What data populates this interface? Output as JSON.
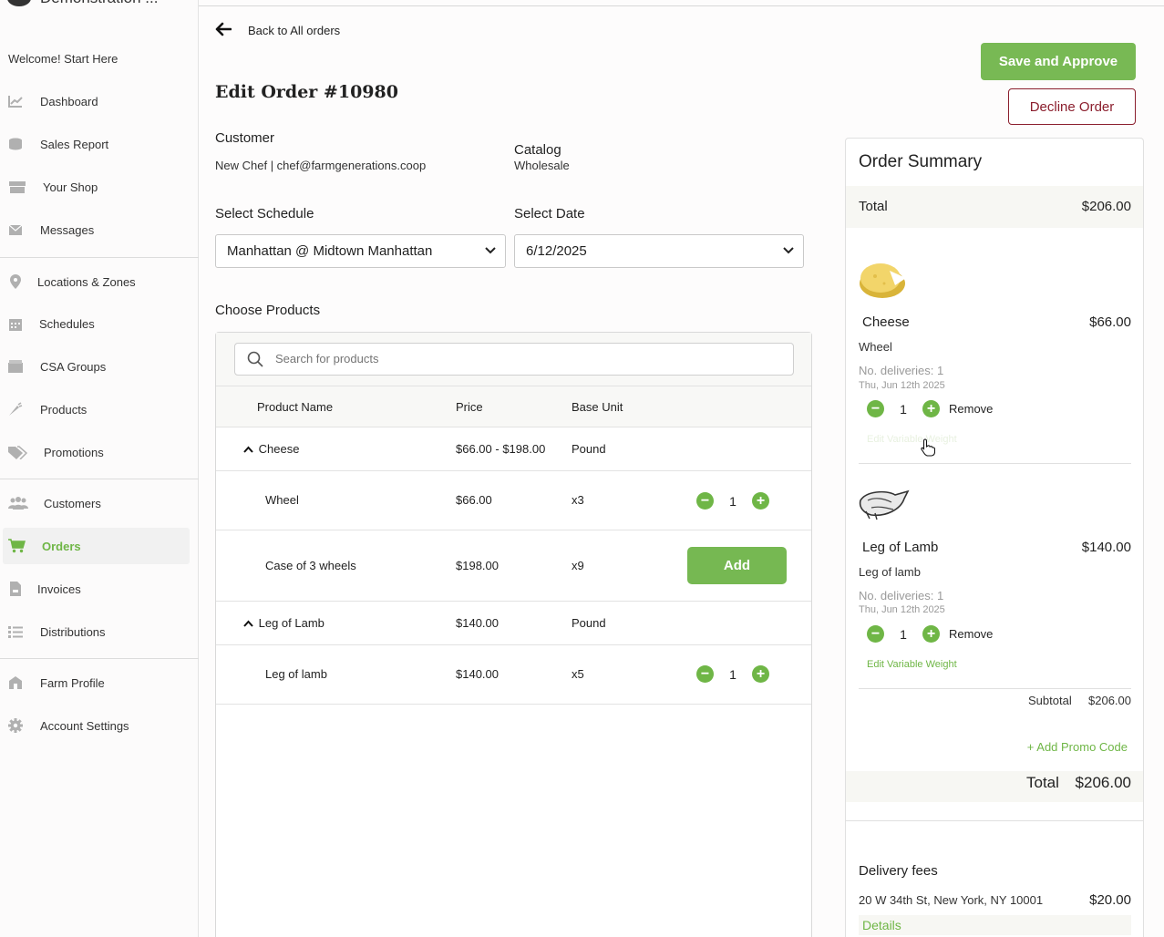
{
  "sidebar": {
    "brand": "Demonstration ...",
    "welcome": "Welcome! Start Here",
    "items": [
      {
        "label": "Dashboard",
        "icon": "chart-icon"
      },
      {
        "label": "Sales Report",
        "icon": "coins-icon"
      },
      {
        "label": "Your Shop",
        "icon": "store-icon"
      },
      {
        "label": "Messages",
        "icon": "envelope-icon"
      },
      {
        "label": "Locations & Zones",
        "icon": "map-pin-icon"
      },
      {
        "label": "Schedules",
        "icon": "calendar-icon"
      },
      {
        "label": "CSA Groups",
        "icon": "box-icon"
      },
      {
        "label": "Products",
        "icon": "carrot-icon"
      },
      {
        "label": "Promotions",
        "icon": "tags-icon"
      },
      {
        "label": "Customers",
        "icon": "users-icon"
      },
      {
        "label": "Orders",
        "icon": "cart-icon"
      },
      {
        "label": "Invoices",
        "icon": "invoice-icon"
      },
      {
        "label": "Distributions",
        "icon": "list-icon"
      },
      {
        "label": "Farm Profile",
        "icon": "barn-icon"
      },
      {
        "label": "Account Settings",
        "icon": "gear-icon"
      }
    ]
  },
  "header": {
    "back_label": "Back to All orders",
    "title": "Edit Order #10980"
  },
  "order": {
    "customer_label": "Customer",
    "customer_value": "New Chef | chef@farmgenerations.coop",
    "catalog_label": "Catalog",
    "catalog_value": "Wholesale",
    "schedule_label": "Select Schedule",
    "schedule_value": "Manhattan @ Midtown Manhattan",
    "date_label": "Select Date",
    "date_value": "6/12/2025",
    "choose_products": "Choose Products"
  },
  "products": {
    "search_placeholder": "Search for products",
    "columns": [
      "Product Name",
      "Price",
      "Base Unit"
    ],
    "rows": [
      {
        "name": "Cheese",
        "price": "$66.00 - $198.00",
        "unit": "Pound"
      },
      {
        "name": "Wheel",
        "price": "$66.00",
        "unit": "x3",
        "qty": "1"
      },
      {
        "name": "Case of 3 wheels",
        "price": "$198.00",
        "unit": "x9",
        "action": "Add"
      },
      {
        "name": "Leg of Lamb",
        "price": "$140.00",
        "unit": "Pound"
      },
      {
        "name": "Leg of lamb",
        "price": "$140.00",
        "unit": "x5",
        "qty": "1"
      }
    ]
  },
  "actions": {
    "approve": "Save and Approve",
    "decline": "Decline Order"
  },
  "summary": {
    "title": "Order Summary",
    "total_label": "Total",
    "total_value": "$206.00",
    "items": [
      {
        "name": "Cheese",
        "price": "$66.00",
        "variant": "Wheel",
        "deliveries": "No. deliveries: 1",
        "date": "Thu, Jun 12th 2025",
        "qty": "1",
        "remove": "Remove",
        "edit_weight": "Edit Variable Weight"
      },
      {
        "name": "Leg of Lamb",
        "price": "$140.00",
        "variant": "Leg of lamb",
        "deliveries": "No. deliveries: 1",
        "date": "Thu, Jun 12th 2025",
        "qty": "1",
        "remove": "Remove",
        "edit_weight": "Edit Variable Weight"
      }
    ],
    "subtotal_label": "Subtotal",
    "subtotal_value": "$206.00",
    "promo": "+ Add Promo Code",
    "grand_total_label": "Total",
    "grand_total_value": "$206.00",
    "delivery_title": "Delivery fees",
    "delivery_address": "20 W 34th St, New York, NY 10001",
    "delivery_fee": "$20.00",
    "details": "Details"
  },
  "colors": {
    "accent": "#6fb646",
    "decline": "#8b1e2d"
  }
}
